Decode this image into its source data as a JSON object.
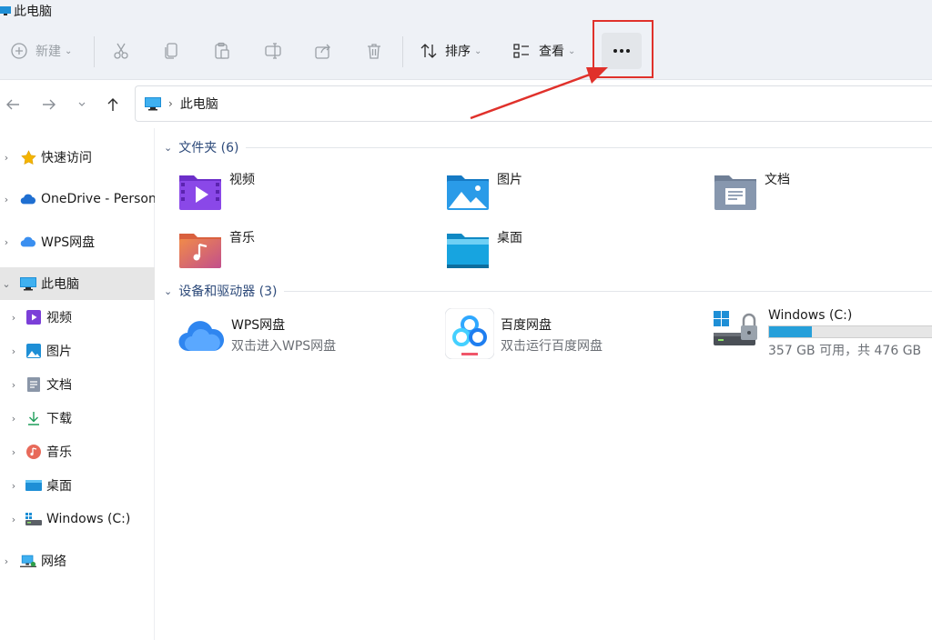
{
  "window": {
    "title": "此电脑"
  },
  "toolbar": {
    "new_label": "新建",
    "sort_label": "排序",
    "view_label": "查看",
    "more_label": "···"
  },
  "address": {
    "crumb": "此电脑"
  },
  "sidebar": {
    "items": [
      {
        "label": "快速访问",
        "icon": "star-icon"
      },
      {
        "label": "OneDrive - Personal",
        "icon": "onedrive-cloud-icon"
      },
      {
        "label": "WPS网盘",
        "icon": "wps-cloud-icon"
      },
      {
        "label": "此电脑",
        "icon": "pc-icon",
        "selected": true
      },
      {
        "label": "视频",
        "icon": "video-folder-icon"
      },
      {
        "label": "图片",
        "icon": "pictures-folder-icon"
      },
      {
        "label": "文档",
        "icon": "documents-folder-icon"
      },
      {
        "label": "下载",
        "icon": "download-icon"
      },
      {
        "label": "音乐",
        "icon": "music-icon"
      },
      {
        "label": "桌面",
        "icon": "desktop-folder-icon"
      },
      {
        "label": "Windows (C:)",
        "icon": "drive-icon"
      },
      {
        "label": "网络",
        "icon": "network-icon"
      }
    ]
  },
  "main": {
    "folders_header": "文件夹 (6)",
    "folders": [
      {
        "label": "视频",
        "icon": "video-folder-icon"
      },
      {
        "label": "图片",
        "icon": "pictures-folder-icon"
      },
      {
        "label": "文档",
        "icon": "documents-folder-icon"
      },
      {
        "label": "音乐",
        "icon": "music-folder-icon"
      },
      {
        "label": "桌面",
        "icon": "desktop-folder-icon"
      }
    ],
    "devices_header": "设备和驱动器 (3)",
    "devices": [
      {
        "name": "WPS网盘",
        "sub": "双击进入WPS网盘",
        "icon": "wps-cloud-icon"
      },
      {
        "name": "百度网盘",
        "sub": "双击运行百度网盘",
        "icon": "baidu-netdisk-icon"
      },
      {
        "name": "Windows (C:)",
        "sub": "357 GB 可用，共 476 GB",
        "icon": "windows-drive-icon",
        "used_fraction": 0.25
      }
    ]
  },
  "colors": {
    "accent": "#26a0da",
    "highlight": "#e0312b",
    "selected_bg": "#e6e6e6"
  }
}
